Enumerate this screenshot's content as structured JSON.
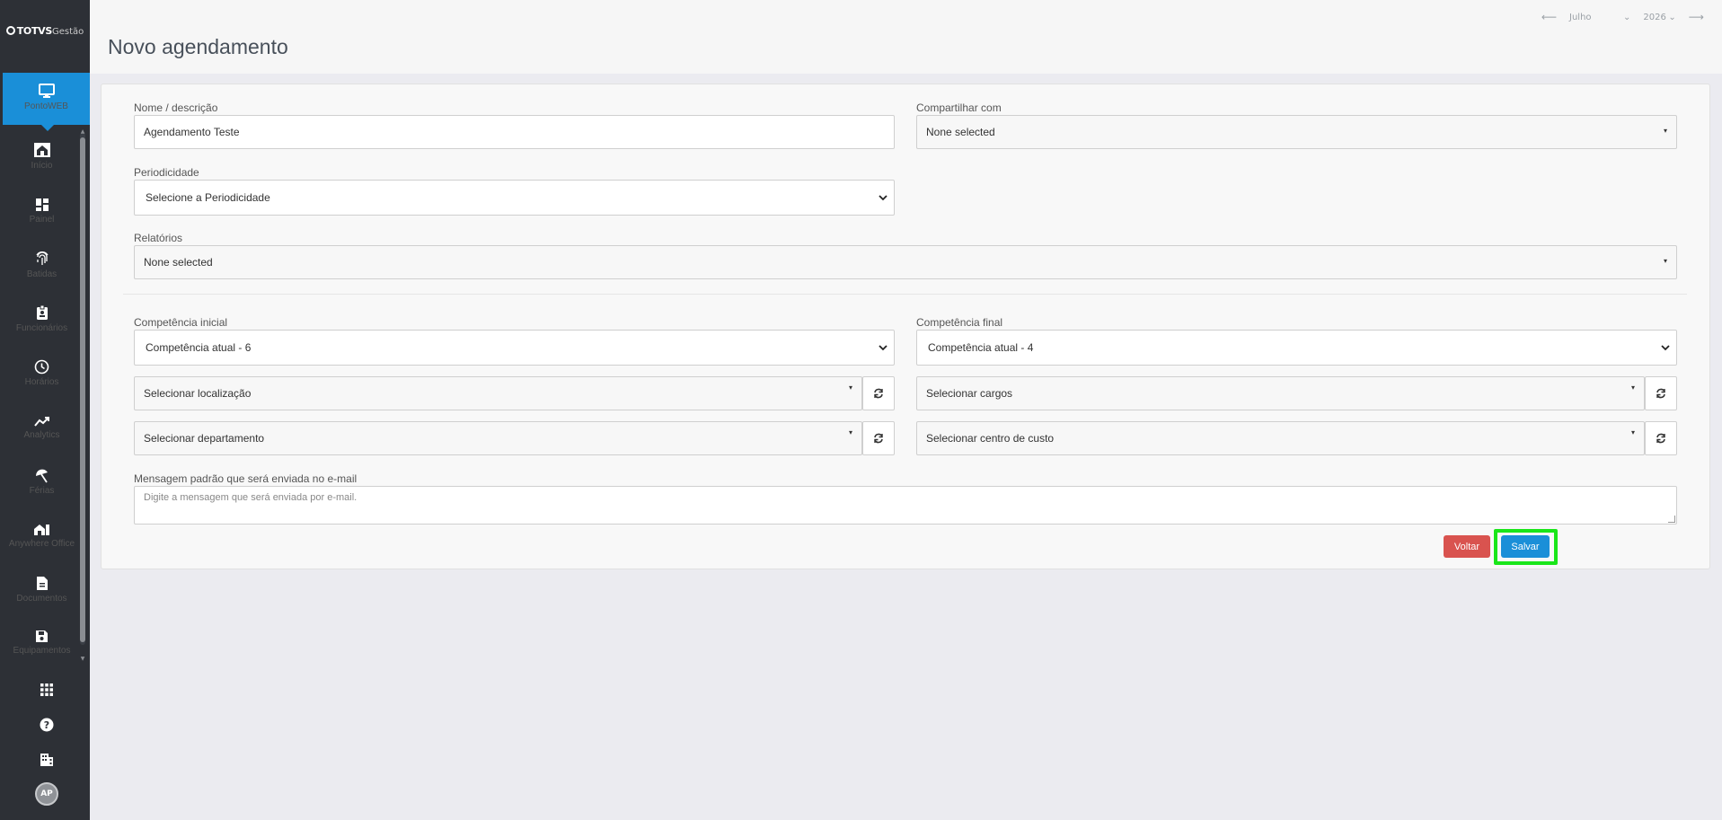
{
  "sidebar": {
    "logo": {
      "brand": "TOTVS",
      "product": "Gestão"
    },
    "module": {
      "label": "PontoWEB",
      "icon": "monitor-icon"
    },
    "items": [
      {
        "label": "Início",
        "icon": "home-icon"
      },
      {
        "label": "Painel",
        "icon": "dashboard-icon"
      },
      {
        "label": "Batidas",
        "icon": "fingerprint-icon"
      },
      {
        "label": "Funcionários",
        "icon": "badge-icon"
      },
      {
        "label": "Horários",
        "icon": "clock-icon"
      },
      {
        "label": "Analytics",
        "icon": "trend-icon"
      },
      {
        "label": "Férias",
        "icon": "umbrella-icon"
      },
      {
        "label": "Anywhere Office",
        "icon": "home-office-icon"
      },
      {
        "label": "Documentos",
        "icon": "document-icon"
      },
      {
        "label": "Equipamentos",
        "icon": "save-device-icon"
      }
    ],
    "bottom_icons": [
      "apps-grid-icon",
      "help-icon",
      "building-icon"
    ],
    "avatar_initials": "AP"
  },
  "header": {
    "title": "Novo agendamento",
    "period": {
      "month": "Julho",
      "year": "2026"
    }
  },
  "form": {
    "nome": {
      "label": "Nome / descrição",
      "value": "Agendamento Teste"
    },
    "compartilhar": {
      "label": "Compartilhar com",
      "value": "None selected"
    },
    "periodicidade": {
      "label": "Periodicidade",
      "value": "Selecione a Periodicidade"
    },
    "relatorios": {
      "label": "Relatórios",
      "value": "None selected"
    },
    "competencia_inicial": {
      "label": "Competência inicial",
      "value": "Competência atual - 6"
    },
    "competencia_final": {
      "label": "Competência final",
      "value": "Competência atual - 4"
    },
    "localizacao": {
      "value": "Selecionar localização"
    },
    "cargos": {
      "value": "Selecionar cargos"
    },
    "departamento": {
      "value": "Selecionar departamento"
    },
    "centro_custo": {
      "value": "Selecionar centro de custo"
    },
    "mensagem": {
      "label": "Mensagem padrão que será enviada no e-mail",
      "placeholder": "Digite a mensagem que será enviada por e-mail."
    }
  },
  "actions": {
    "voltar": "Voltar",
    "salvar": "Salvar"
  },
  "colors": {
    "primary": "#1a8fd8",
    "danger": "#d9534f",
    "sidebar": "#2d3036",
    "highlight": "#19e619"
  }
}
